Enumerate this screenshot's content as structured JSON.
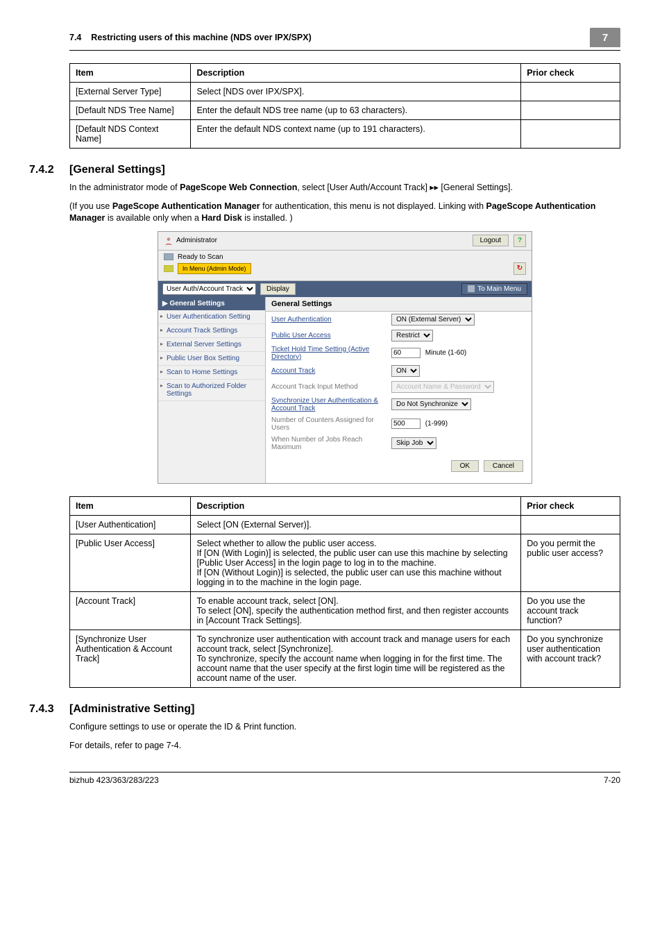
{
  "header": {
    "section_no": "7.4",
    "section_title": "Restricting users of this machine (NDS over IPX/SPX)",
    "chapter_box": "7"
  },
  "table1": {
    "headers": {
      "item": "Item",
      "desc": "Description",
      "prior": "Prior check"
    },
    "rows": [
      {
        "item": "[External Server Type]",
        "desc": "Select [NDS over IPX/SPX].",
        "prior": ""
      },
      {
        "item": "[Default NDS Tree Name]",
        "desc": "Enter the default NDS tree name (up to 63 characters).",
        "prior": ""
      },
      {
        "item": "[Default NDS Context Name]",
        "desc": "Enter the default NDS context name (up to 191 characters).",
        "prior": ""
      }
    ]
  },
  "sec742": {
    "num": "7.4.2",
    "title": "[General Settings]",
    "p1_a": "In the administrator mode of ",
    "p1_b": "PageScope Web Connection",
    "p1_c": ", select [User Auth/Account Track] ▸▸ [General Settings].",
    "p2_a": "(If you use ",
    "p2_b": "PageScope Authentication Manager",
    "p2_c": " for authentication, this menu is not displayed. Linking with ",
    "p2_d": "PageScope Authentication Manager",
    "p2_e": " is available only when a ",
    "p2_f": "Hard Disk",
    "p2_g": " is installed. )"
  },
  "screenshot": {
    "admin_label": "Administrator",
    "logout": "Logout",
    "help": "?",
    "ready": "Ready to Scan",
    "menu_mode": "In Menu (Admin Mode)",
    "dropdown": "User Auth/Account Track",
    "display": "Display",
    "to_main": "To Main Menu",
    "side_header": "General Settings",
    "side_items": [
      "User Authentication Setting",
      "Account Track Settings",
      "External Server Settings",
      "Public User Box Setting",
      "Scan to Home Settings",
      "Scan to Authorized Folder Settings"
    ],
    "main_title": "General Settings",
    "rows": {
      "r1": {
        "k": "User Authentication",
        "sel": "ON (External Server)"
      },
      "r2": {
        "k": "Public User Access",
        "sel": "Restrict"
      },
      "r3": {
        "k": "Ticket Hold Time Setting (Active Directory)",
        "val": "60",
        "suffix": "Minute (1-60)"
      },
      "r4": {
        "k": "Account Track",
        "sel": "ON"
      },
      "r5": {
        "k": "Account Track Input Method",
        "sel": "Account Name & Password"
      },
      "r6": {
        "k": "Synchronize User Authentication & Account Track",
        "sel": "Do Not Synchronize"
      },
      "r7": {
        "k": "Number of Counters Assigned for Users",
        "val": "500",
        "suffix": "(1-999)"
      },
      "r8": {
        "k": "When Number of Jobs Reach Maximum",
        "sel": "Skip Job"
      }
    },
    "ok": "OK",
    "cancel": "Cancel"
  },
  "table2": {
    "headers": {
      "item": "Item",
      "desc": "Description",
      "prior": "Prior check"
    },
    "rows": [
      {
        "item": "[User Authentication]",
        "desc": "Select [ON (External Server)].",
        "prior": ""
      },
      {
        "item": "[Public User Access]",
        "desc": "Select whether to allow the public user access.\nIf [ON (With Login)] is selected, the public user can use this machine by selecting [Public User Access] in the login page to log in to the machine.\nIf [ON (Without Login)] is selected, the public user can use this machine without logging in to the machine in the login page.",
        "prior": "Do you permit the public user access?"
      },
      {
        "item": "[Account Track]",
        "desc": "To enable account track, select [ON].\nTo select [ON], specify the authentication method first, and then register accounts in [Account Track Settings].",
        "prior": "Do you use the account track function?"
      },
      {
        "item": "[Synchronize User Authentication & Account Track]",
        "desc": "To synchronize user authentication with account track and manage users for each account track, select [Synchronize].\nTo synchronize, specify the account name when logging in for the first time. The account name that the user specify at the first login time will be registered as the account name of the user.",
        "prior": "Do you synchronize user authentication with account track?"
      }
    ]
  },
  "sec743": {
    "num": "7.4.3",
    "title": "[Administrative Setting]",
    "p1": "Configure settings to use or operate the ID & Print function.",
    "p2": "For details, refer to page 7-4."
  },
  "footer": {
    "left": "bizhub 423/363/283/223",
    "right": "7-20"
  }
}
